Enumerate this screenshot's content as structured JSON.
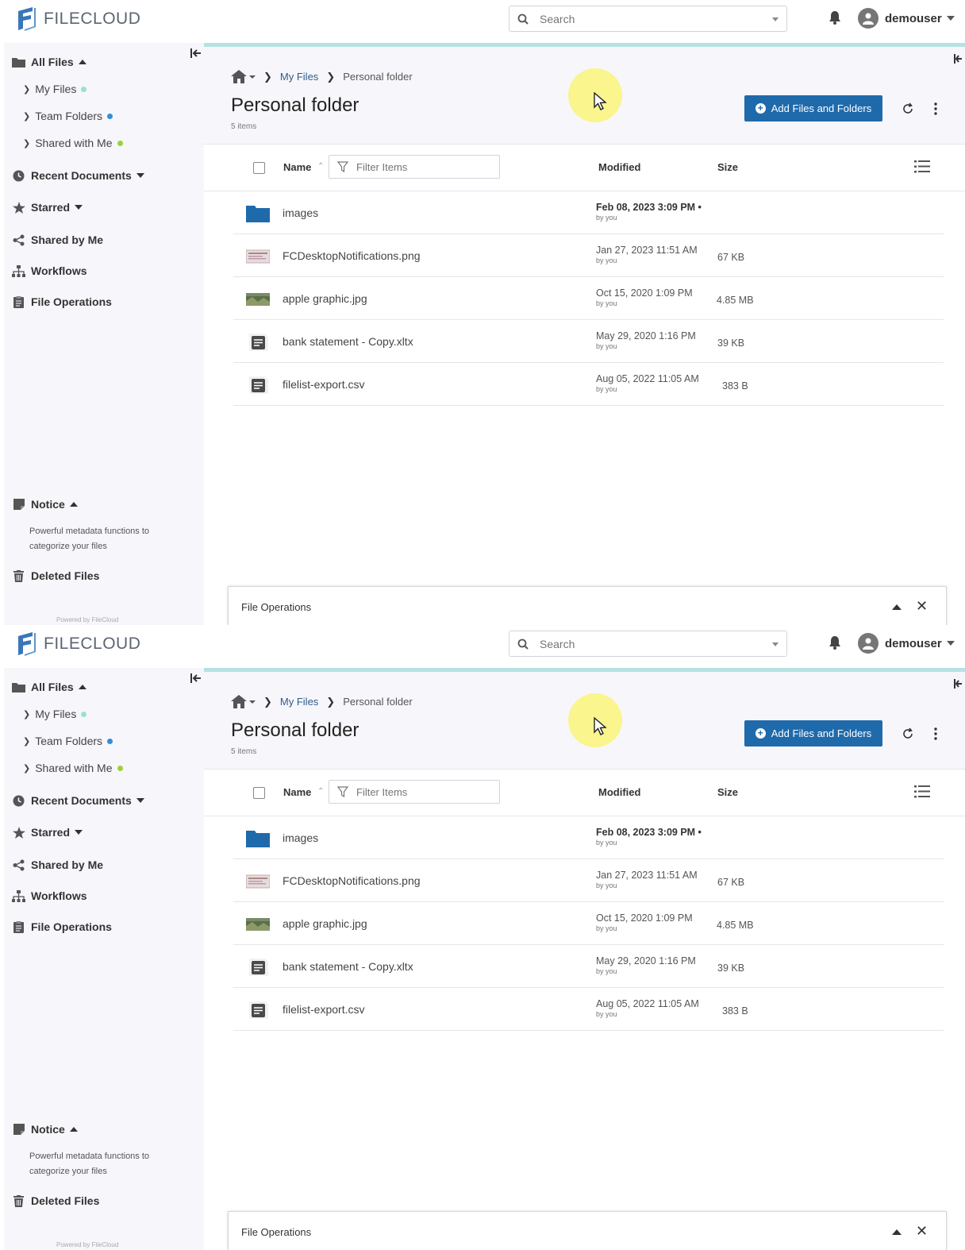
{
  "app": {
    "logo_text": "FILECLOUD"
  },
  "search": {
    "placeholder": "Search"
  },
  "user": {
    "name": "demouser"
  },
  "sidebar": {
    "all_files": "All Files",
    "my_files": "My Files",
    "team_folders": "Team Folders",
    "shared_with_me": "Shared with Me",
    "recent_documents": "Recent Documents",
    "starred": "Starred",
    "shared_by_me": "Shared by Me",
    "workflows": "Workflows",
    "file_operations": "File Operations",
    "notice": "Notice",
    "notice_text": "Powerful metadata functions to categorize your files",
    "deleted_files": "Deleted Files",
    "powered_by": "Powered by FileCloud",
    "dot_colors": {
      "my_files": "#9adfd6",
      "team_folders": "#2f8fd8",
      "shared_with_me": "#9ad23a"
    }
  },
  "breadcrumb": {
    "my_files": "My Files",
    "current": "Personal folder"
  },
  "folder": {
    "title": "Personal folder",
    "count": "5 items"
  },
  "toolbar": {
    "add_label": "Add Files and Folders"
  },
  "table": {
    "headers": {
      "name": "Name",
      "modified": "Modified",
      "size": "Size"
    },
    "filter_placeholder": "Filter Items",
    "rows": [
      {
        "name": "images",
        "modified": "Feb 08, 2023 3:09 PM •",
        "by": "by you",
        "size": "",
        "type": "folder-icon"
      },
      {
        "name": "FCDesktopNotifications.png",
        "modified": "Jan 27, 2023 11:51 AM",
        "by": "by you",
        "size": "67 KB",
        "type": "image-thumbnail-icon"
      },
      {
        "name": "apple graphic.jpg",
        "modified": "Oct 15, 2020 1:09 PM",
        "by": "by you",
        "size": "4.85 MB",
        "type": "photo-thumbnail-icon"
      },
      {
        "name": "bank statement - Copy.xltx",
        "modified": "May 29, 2020 1:16 PM",
        "by": "by you",
        "size": "39 KB",
        "type": "document-icon"
      },
      {
        "name": "filelist-export.csv",
        "modified": "Aug 05, 2022 11:05 AM",
        "by": "by you",
        "size": "383 B",
        "type": "document-icon"
      }
    ]
  },
  "file_operations_panel": {
    "label": "File Operations"
  },
  "colors": {
    "accent": "#1f6aab",
    "progress": "#b5e2e3",
    "sidebar_bg": "#f7f6fa",
    "folder": "#1f6aab"
  }
}
